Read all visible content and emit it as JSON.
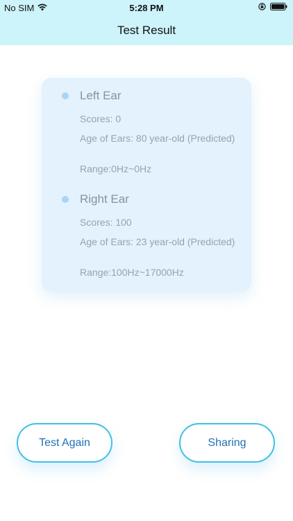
{
  "status_bar": {
    "carrier": "No SIM",
    "time": "5:28 PM",
    "wifi_icon": "wifi-icon",
    "lock_icon": "rotation-lock-icon",
    "battery_icon": "battery-icon"
  },
  "nav": {
    "title": "Test Result"
  },
  "results": {
    "left": {
      "title": "Left Ear",
      "scores": "Scores: 0",
      "age": "Age of Ears: 80 year-old (Predicted)",
      "range": "Range:0Hz~0Hz"
    },
    "right": {
      "title": "Right Ear",
      "scores": "Scores: 100",
      "age": "Age of Ears: 23 year-old (Predicted)",
      "range": "Range:100Hz~17000Hz"
    }
  },
  "actions": {
    "test_again": "Test Again",
    "sharing": "Sharing"
  },
  "colors": {
    "header_bg": "#cdf3fb",
    "card_bg": "#e3f2fd",
    "dot": "#a9d4f5",
    "button_border": "#3fc0e6",
    "button_text": "#1f6fb7"
  }
}
